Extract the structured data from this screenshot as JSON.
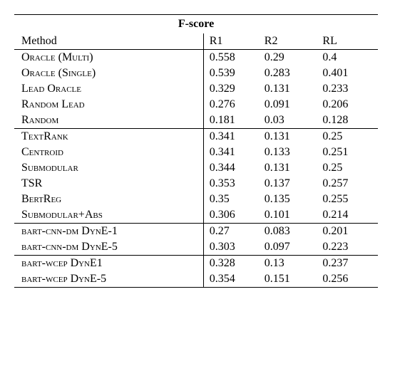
{
  "header": {
    "title": "F-score",
    "cols": {
      "method": "Method",
      "r1": "R1",
      "r2": "R2",
      "rl": "RL"
    }
  },
  "groups": [
    {
      "rows": [
        {
          "method_sc": "Oracle (Multi)",
          "r1": "0.558",
          "r2": "0.29",
          "rl": "0.4"
        },
        {
          "method_sc": "Oracle (Single)",
          "r1": "0.539",
          "r2": "0.283",
          "rl": "0.401"
        },
        {
          "method_sc": "Lead Oracle",
          "r1": "0.329",
          "r2": "0.131",
          "rl": "0.233"
        },
        {
          "method_sc": "Random Lead",
          "r1": "0.276",
          "r2": "0.091",
          "rl": "0.206"
        },
        {
          "method_sc": "Random",
          "r1": "0.181",
          "r2": "0.03",
          "rl": "0.128"
        }
      ]
    },
    {
      "rows": [
        {
          "method_sc": "TextRank",
          "r1": "0.341",
          "r2": "0.131",
          "rl": "0.25"
        },
        {
          "method_sc": "Centroid",
          "r1": "0.341",
          "r2": "0.133",
          "rl": "0.251"
        },
        {
          "method_sc": "Submodular",
          "r1": "0.344",
          "r2": "0.131",
          "rl": "0.25"
        },
        {
          "method_plain": "TSR",
          "r1": "0.353",
          "r2": "0.137",
          "rl": "0.257"
        },
        {
          "method_sc": "BertReg",
          "r1": "0.35",
          "r2": "0.135",
          "rl": "0.255"
        },
        {
          "method_sc": "Submodular+Abs",
          "r1": "0.306",
          "r2": "0.101",
          "rl": "0.214"
        }
      ]
    },
    {
      "rows": [
        {
          "method_mixed": {
            "sc1": "bart-cnn-dm",
            "plain": " ",
            "sc2": "DynE-1"
          },
          "r1": "0.27",
          "r2": "0.083",
          "rl": "0.201"
        },
        {
          "method_mixed": {
            "sc1": "bart-cnn-dm",
            "plain": " ",
            "sc2": "DynE-5"
          },
          "r1": "0.303",
          "r2": "0.097",
          "rl": "0.223"
        }
      ]
    },
    {
      "rows": [
        {
          "method_mixed": {
            "sc1": "bart-wcep",
            "plain": " ",
            "sc2": "DynE1"
          },
          "r1": "0.328",
          "r2": "0.13",
          "rl": "0.237"
        },
        {
          "method_mixed": {
            "sc1": "bart-wcep",
            "plain": " ",
            "sc2": "DynE-5"
          },
          "r1": "0.354",
          "r2": "0.151",
          "rl": "0.256"
        }
      ]
    }
  ],
  "chart_data": {
    "type": "table",
    "title": "F-score",
    "columns": [
      "Method",
      "R1",
      "R2",
      "RL"
    ],
    "rows": [
      [
        "ORACLE (MULTI)",
        0.558,
        0.29,
        0.4
      ],
      [
        "ORACLE (SINGLE)",
        0.539,
        0.283,
        0.401
      ],
      [
        "LEAD ORACLE",
        0.329,
        0.131,
        0.233
      ],
      [
        "RANDOM LEAD",
        0.276,
        0.091,
        0.206
      ],
      [
        "RANDOM",
        0.181,
        0.03,
        0.128
      ],
      [
        "TEXTRANK",
        0.341,
        0.131,
        0.25
      ],
      [
        "CENTROID",
        0.341,
        0.133,
        0.251
      ],
      [
        "SUBMODULAR",
        0.344,
        0.131,
        0.25
      ],
      [
        "TSR",
        0.353,
        0.137,
        0.257
      ],
      [
        "BERTREG",
        0.35,
        0.135,
        0.255
      ],
      [
        "SUBMODULAR+ABS",
        0.306,
        0.101,
        0.214
      ],
      [
        "BART-CNN-DM DYNE-1",
        0.27,
        0.083,
        0.201
      ],
      [
        "BART-CNN-DM DYNE-5",
        0.303,
        0.097,
        0.223
      ],
      [
        "BART-WCEP DYNE1",
        0.328,
        0.13,
        0.237
      ],
      [
        "BART-WCEP DYNE-5",
        0.354,
        0.151,
        0.256
      ]
    ]
  }
}
